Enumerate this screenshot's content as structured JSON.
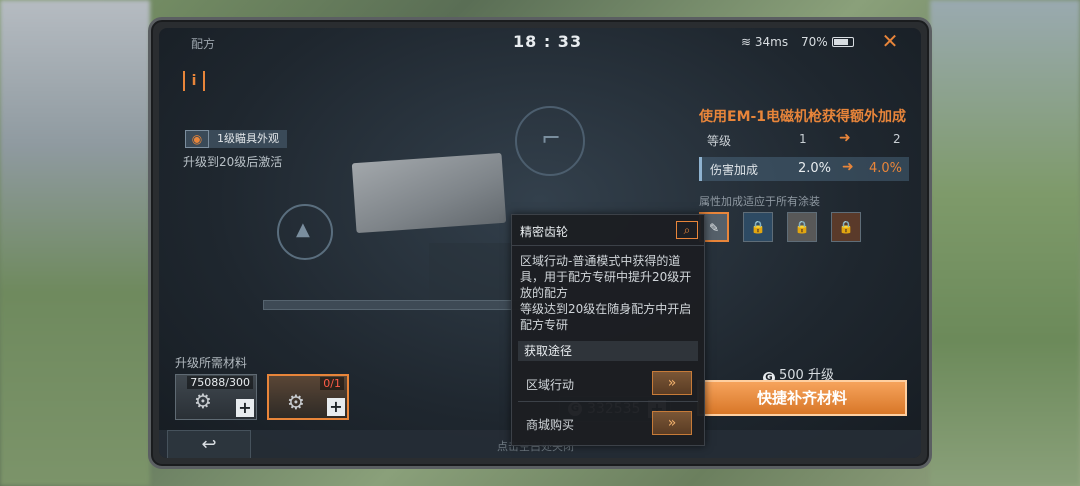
{
  "status": {
    "title": "配方",
    "clock": "18 : 33",
    "latency": "34ms",
    "battery": "70%"
  },
  "left": {
    "skin_label": "1级瞄具外观",
    "unlock_text": "升级到20级后激活"
  },
  "bonus": {
    "title": "使用EM-1电磁机枪获得额外加成",
    "level_label": "等级",
    "level_from": "1",
    "level_to": "2",
    "damage_label": "伤害加成",
    "damage_from": "2.0%",
    "damage_to": "4.0%",
    "skins_note": "属性加成适应于所有涂装"
  },
  "materials": {
    "title": "升级所需材料",
    "item1_count": "75088/300",
    "item2_count": "0/1"
  },
  "currency": {
    "balance": "332535",
    "cost": "500 升级"
  },
  "actions": {
    "quick_fill": "快捷补齐材料",
    "close_hint": "点击空白处关闭"
  },
  "tooltip": {
    "title": "精密齿轮",
    "description": "区域行动-普通模式中获得的道具，用于配方专研中提升20级开放的配方\n等级达到20级在随身配方中开启配方专研",
    "section_title": "获取途径",
    "source1": "区域行动",
    "source2": "商城购买"
  }
}
